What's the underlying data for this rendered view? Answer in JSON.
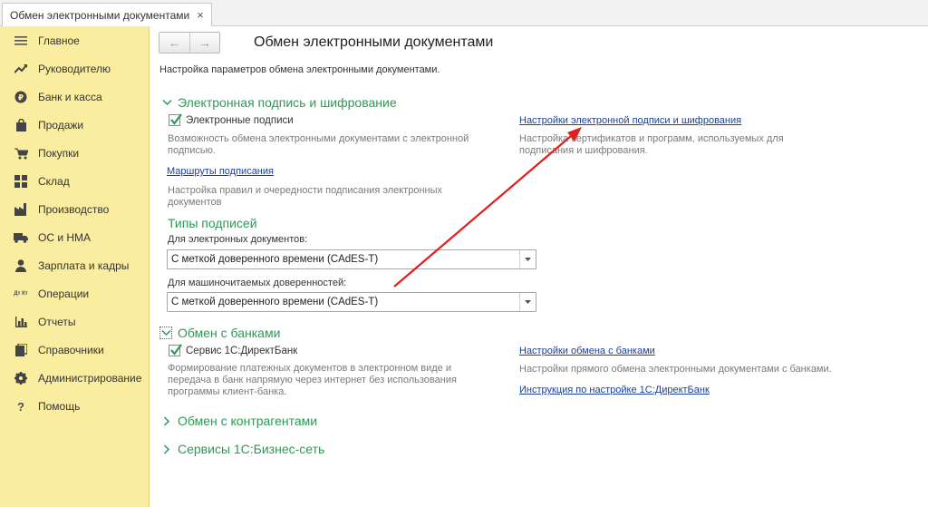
{
  "tab": {
    "title": "Обмен электронными документами",
    "close": "×"
  },
  "sidebar": {
    "items": [
      {
        "label": "Главное",
        "icon": "menu-icon"
      },
      {
        "label": "Руководителю",
        "icon": "trend-icon"
      },
      {
        "label": "Банк и касса",
        "icon": "coin-icon"
      },
      {
        "label": "Продажи",
        "icon": "bag-icon"
      },
      {
        "label": "Покупки",
        "icon": "cart-icon"
      },
      {
        "label": "Склад",
        "icon": "warehouse-icon"
      },
      {
        "label": "Производство",
        "icon": "factory-icon"
      },
      {
        "label": "ОС и НМА",
        "icon": "truck-icon"
      },
      {
        "label": "Зарплата и кадры",
        "icon": "person-icon"
      },
      {
        "label": "Операции",
        "icon": "dt-kt-icon",
        "glyph": "Дт Кт"
      },
      {
        "label": "Отчеты",
        "icon": "bar-chart-icon"
      },
      {
        "label": "Справочники",
        "icon": "books-icon"
      },
      {
        "label": "Администрирование",
        "icon": "gear-icon"
      },
      {
        "label": "Помощь",
        "icon": "question-icon",
        "glyph": "?"
      }
    ]
  },
  "header": {
    "back": "←",
    "forward": "→",
    "title": "Обмен электронными документами",
    "description": "Настройка параметров обмена электронными документами."
  },
  "sections": {
    "signature": {
      "title": "Электронная подпись и шифрование",
      "checkbox_label": "Электронные подписи",
      "checkbox_hint": "Возможность обмена электронными документами с электронной подписью.",
      "routes_link": "Маршруты подписания",
      "routes_hint": "Настройка правил и очередности подписания электронных документов",
      "settings_link": "Настройки электронной подписи и шифрования",
      "settings_hint": "Настройка сертификатов и программ, используемых для подписания и шифрования.",
      "types_title": "Типы подписей",
      "edoc_label": "Для электронных документов:",
      "edoc_value": "С меткой доверенного времени (CAdES-T)",
      "mchd_label": "Для машиночитаемых доверенностей:",
      "mchd_value": "С меткой доверенного времени (CAdES-T)"
    },
    "banks": {
      "title": "Обмен с банками",
      "checkbox_label": "Сервис 1С:ДиректБанк",
      "checkbox_hint": "Формирование платежных документов в электронном виде и передача в банк напрямую через интернет без использования программы клиент-банка.",
      "settings_link": "Настройки обмена с банками",
      "settings_hint": "Настройки прямого обмена электронными документами с банками.",
      "instruction_link": "Инструкция по настройке 1С:ДиректБанк"
    },
    "contractors": {
      "title": "Обмен с контрагентами"
    },
    "business_network": {
      "title": "Сервисы 1С:Бизнес-сеть"
    }
  },
  "colors": {
    "sidebar_bg": "#fbeda0",
    "section_green": "#2c9a54",
    "link_blue": "#1a3f9c",
    "annotation_red": "#e0201c"
  }
}
